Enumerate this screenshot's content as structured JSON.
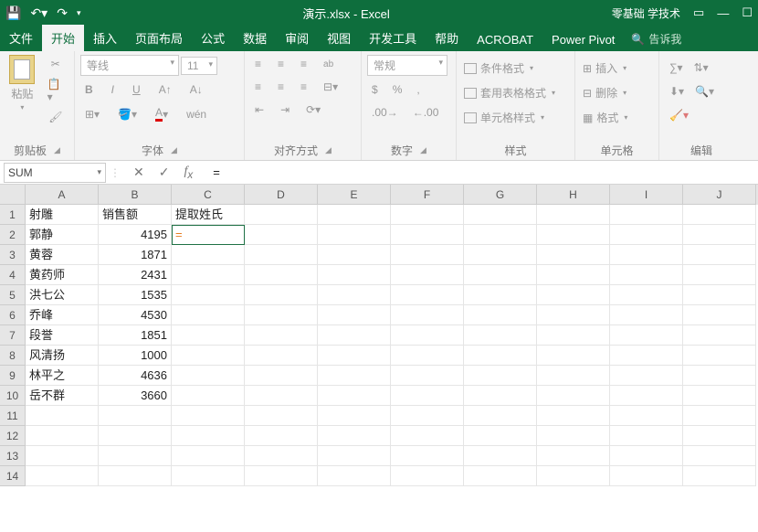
{
  "title": "演示.xlsx - Excel",
  "title_link": "零基础 学技术",
  "qat": {
    "save": "💾"
  },
  "tabs": [
    "文件",
    "开始",
    "插入",
    "页面布局",
    "公式",
    "数据",
    "审阅",
    "视图",
    "开发工具",
    "帮助",
    "ACROBAT",
    "Power Pivot"
  ],
  "tell_me": "告诉我",
  "active_tab": 1,
  "ribbon": {
    "clipboard": {
      "paste": "粘贴",
      "label": "剪贴板"
    },
    "font": {
      "name": "等线",
      "size": "11",
      "label": "字体",
      "bold": "B",
      "italic": "I",
      "underline": "U",
      "phonetic": "wén"
    },
    "align": {
      "label": "对齐方式",
      "wrap": "ab"
    },
    "number": {
      "format": "常规",
      "label": "数字",
      "percent": "%",
      "comma": ",",
      "currency": "$"
    },
    "styles": {
      "cond": "条件格式",
      "table": "套用表格格式",
      "cell": "单元格样式",
      "label": "样式"
    },
    "cells": {
      "insert": "插入",
      "delete": "删除",
      "format": "格式",
      "label": "单元格"
    },
    "editing": {
      "label": "编辑"
    }
  },
  "namebox": "SUM",
  "formula_btns": {
    "cancel": "✕",
    "ok": "✓"
  },
  "formula": "=",
  "columns": [
    "A",
    "B",
    "C",
    "D",
    "E",
    "F",
    "G",
    "H",
    "I",
    "J"
  ],
  "rows": [
    "1",
    "2",
    "3",
    "4",
    "5",
    "6",
    "7",
    "8",
    "9",
    "10",
    "11",
    "12",
    "13",
    "14"
  ],
  "grid": {
    "headers": [
      "射雕",
      "销售额",
      "提取姓氏"
    ],
    "data": [
      {
        "a": "郭静",
        "b": "4195"
      },
      {
        "a": "黄蓉",
        "b": "1871"
      },
      {
        "a": "黄药师",
        "b": "2431"
      },
      {
        "a": "洪七公",
        "b": "1535"
      },
      {
        "a": "乔峰",
        "b": "4530"
      },
      {
        "a": "段誉",
        "b": "1851"
      },
      {
        "a": "风清扬",
        "b": "1000"
      },
      {
        "a": "林平之",
        "b": "4636"
      },
      {
        "a": "岳不群",
        "b": "3660"
      }
    ],
    "active_cell": "="
  }
}
